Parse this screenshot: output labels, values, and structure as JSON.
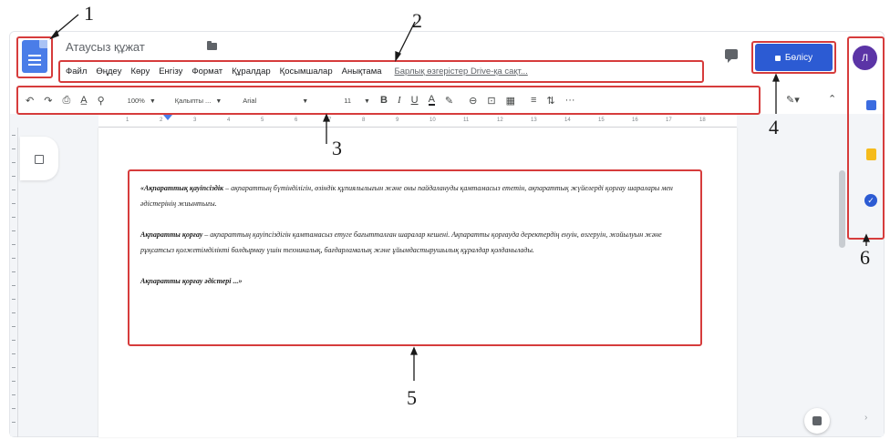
{
  "doc": {
    "title": "Атаусыз құжат",
    "share_label": "Бөлісу",
    "avatar_letter": "Л"
  },
  "menu": {
    "items": [
      "Файл",
      "Өңдеу",
      "Көру",
      "Енгізу",
      "Формат",
      "Құралдар",
      "Қосымшалар",
      "Анықтама"
    ],
    "last_edit": "Барлық өзгерістер Drive-қа сақт..."
  },
  "toolbar": {
    "undo": "↶",
    "redo": "↷",
    "print": "⎙",
    "spellcheck": "A̲",
    "paint_format": "⚲",
    "zoom": "100%",
    "style": "Қалыпты ...",
    "font": "Arial",
    "font_size": "11",
    "bold": "B",
    "italic": "I",
    "underline": "U",
    "text_color": "A",
    "highlight": "✎",
    "link": "⊖",
    "comment": "⊡",
    "image": "▦",
    "align": "≡",
    "line_spacing": "⇅",
    "more": "···"
  },
  "ruler_ticks": [
    "1",
    "2",
    "3",
    "4",
    "5",
    "6",
    "7",
    "8",
    "9",
    "10",
    "11",
    "12",
    "13",
    "14",
    "15",
    "16",
    "17",
    "18"
  ],
  "document_body": {
    "p1_bold": "«Ақпараттық қауіпсіздік",
    "p1_rest": " – ақпараттың бүтінділігін, өзіндік құпиялылығын және оны пайдалануды қамтамасыз ететін, ақпараттық жүйелерді қорғау шаралары мен әдістерінің жиынтығы.",
    "p2_bold": "Ақпаратты қорғау",
    "p2_rest": " – ақпараттың қауіпсіздігін қамтамасыз етуге бағытталған шаралар кешені. Ақпаратты қорғауда деректердің енуін, өзгеруін, жойылуын және рұқсатсыз қолжетімділікті болдырмау үшін техникалық, бағдарламалық және ұйымдастырушылық құралдар қолданылады.",
    "p3_bold": "Ақпаратты қорғау әдістері ...»"
  },
  "side_panel": {
    "icons": [
      "calendar-icon",
      "keep-icon",
      "tasks-icon"
    ]
  },
  "callouts": {
    "numbers": [
      "1",
      "2",
      "3",
      "4",
      "5",
      "6"
    ]
  },
  "colors": {
    "callout": "#d63c3c",
    "share": "#2c5bd3",
    "avatar": "#5b34a6",
    "doc_icon": "#4a7de8"
  }
}
